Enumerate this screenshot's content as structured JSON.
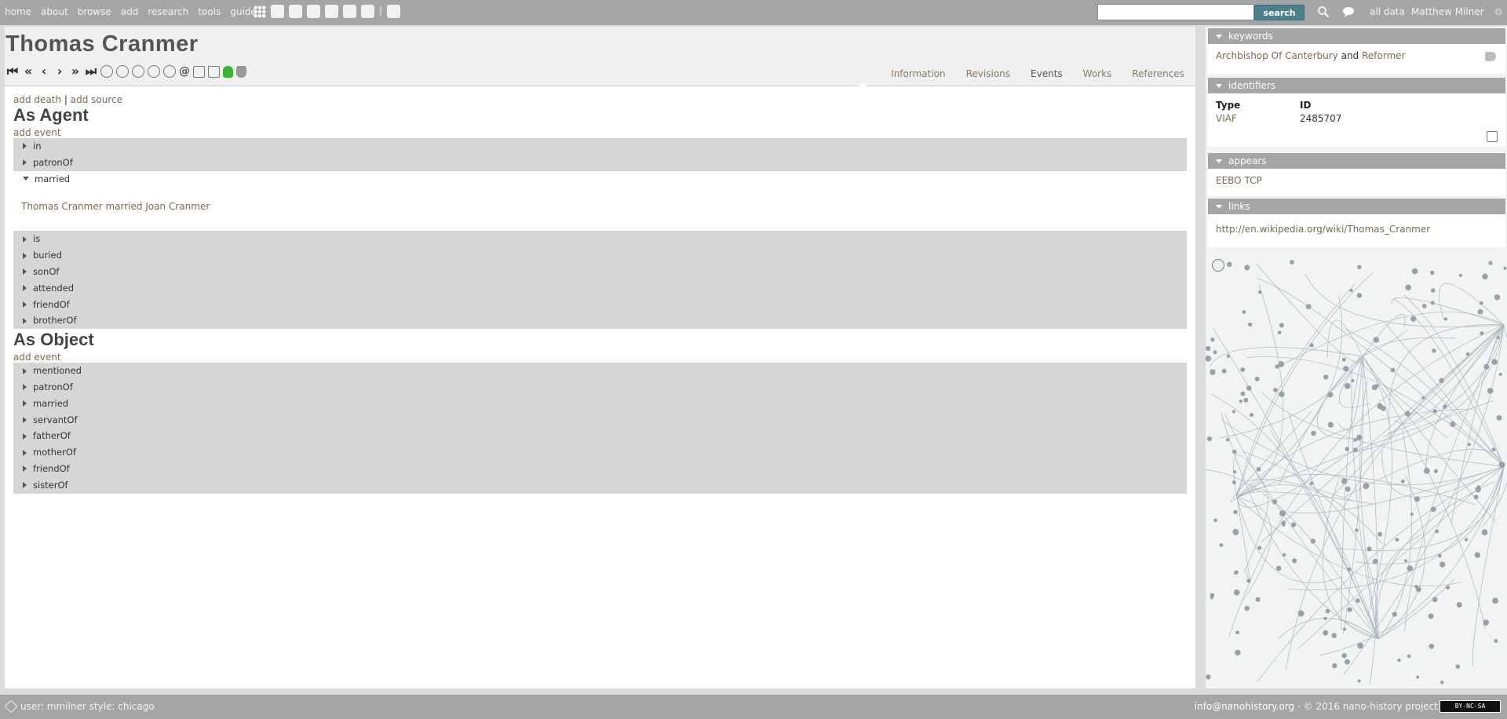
{
  "topnav": [
    "home",
    "about",
    "browse",
    "add",
    "research",
    "tools",
    "guide"
  ],
  "topbar": {
    "search_button": "search",
    "all_data": "all data",
    "user_name": "Matthew Milner",
    "separator": "|"
  },
  "page": {
    "title": "Thomas Cranmer",
    "tabs": [
      {
        "label": "Information"
      },
      {
        "label": "Revisions"
      },
      {
        "label": "Events",
        "active": true
      },
      {
        "label": "Works"
      },
      {
        "label": "References"
      }
    ],
    "add_death": "add death",
    "link_sep": "|",
    "add_source": "add source",
    "at_symbol": "@"
  },
  "as_agent": {
    "title": "As Agent",
    "add_event": "add event",
    "items_before": [
      "in",
      "patronOf"
    ],
    "expanded": {
      "label": "married",
      "sentence": "Thomas Cranmer married Joan Cranmer"
    },
    "items_after": [
      "is",
      "buried",
      "sonOf",
      "attended",
      "friendOf",
      "brotherOf"
    ]
  },
  "as_object": {
    "title": "As Object",
    "add_event": "add event",
    "items": [
      "mentioned",
      "patronOf",
      "married",
      "servantOf",
      "fatherOf",
      "motherOf",
      "friendOf",
      "sisterOf"
    ]
  },
  "sidebar": {
    "keywords": {
      "title": "keywords",
      "k1": "Archbishop Of Canterbury",
      "and": "and",
      "k2": "Reformer"
    },
    "identifiers": {
      "title": "identifiers",
      "col_type": "Type",
      "col_id": "ID",
      "type": "VIAF",
      "id": "2485707"
    },
    "appears": {
      "title": "appears",
      "item": "EEBO TCP"
    },
    "links": {
      "title": "links",
      "url": "http://en.wikipedia.org/wiki/Thomas_Cranmer"
    }
  },
  "footer": {
    "left": "user: mmilner style: chicago",
    "email": "info@nanohistory.org",
    "copyright": "· © 2016 nano-history project",
    "license": "BY-NC-SA"
  },
  "colors": {
    "bar": "#a3a5a6",
    "accent": "#4e7f8d",
    "link": "#7a6a55",
    "row_bg": "#d6d6d6"
  }
}
